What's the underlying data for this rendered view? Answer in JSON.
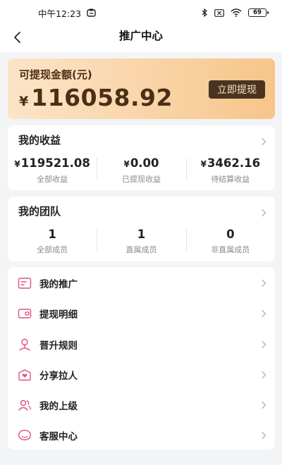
{
  "status_bar": {
    "time": "中午12:23",
    "battery": "69",
    "icons": [
      "app-notification-icon",
      "bluetooth-icon",
      "sim-off-icon",
      "wifi-icon",
      "battery-icon"
    ]
  },
  "nav": {
    "title": "推广中心",
    "back_icon": "back-arrow-icon"
  },
  "balance": {
    "label": "可提现金额(元)",
    "currency": "¥",
    "amount": "116058.92",
    "withdraw_label": "立即提现"
  },
  "earnings": {
    "title": "我的收益",
    "stats": [
      {
        "currency": "¥",
        "value": "119521.08",
        "label": "全部收益"
      },
      {
        "currency": "¥",
        "value": "0.00",
        "label": "已提现收益"
      },
      {
        "currency": "¥",
        "value": "3462.16",
        "label": "待结算收益"
      }
    ]
  },
  "team": {
    "title": "我的团队",
    "stats": [
      {
        "value": "1",
        "label": "全部成员"
      },
      {
        "value": "1",
        "label": "直属成员"
      },
      {
        "value": "0",
        "label": "非直属成员"
      }
    ]
  },
  "menu": {
    "items": [
      {
        "label": "我的推广",
        "icon": "promotion-card-icon"
      },
      {
        "label": "提现明细",
        "icon": "wallet-icon"
      },
      {
        "label": "晋升规则",
        "icon": "rank-badge-icon"
      },
      {
        "label": "分享拉人",
        "icon": "share-heart-icon"
      },
      {
        "label": "我的上级",
        "icon": "superior-users-icon"
      },
      {
        "label": "客服中心",
        "icon": "customer-service-icon"
      }
    ]
  },
  "colors": {
    "accent_icon": "#e0527a",
    "balance_text": "#4a2f17",
    "withdraw_button": "#4a3421",
    "withdraw_text": "#fbe1bd",
    "gradient_start": "#fce4c8",
    "gradient_end": "#f6c58a"
  }
}
